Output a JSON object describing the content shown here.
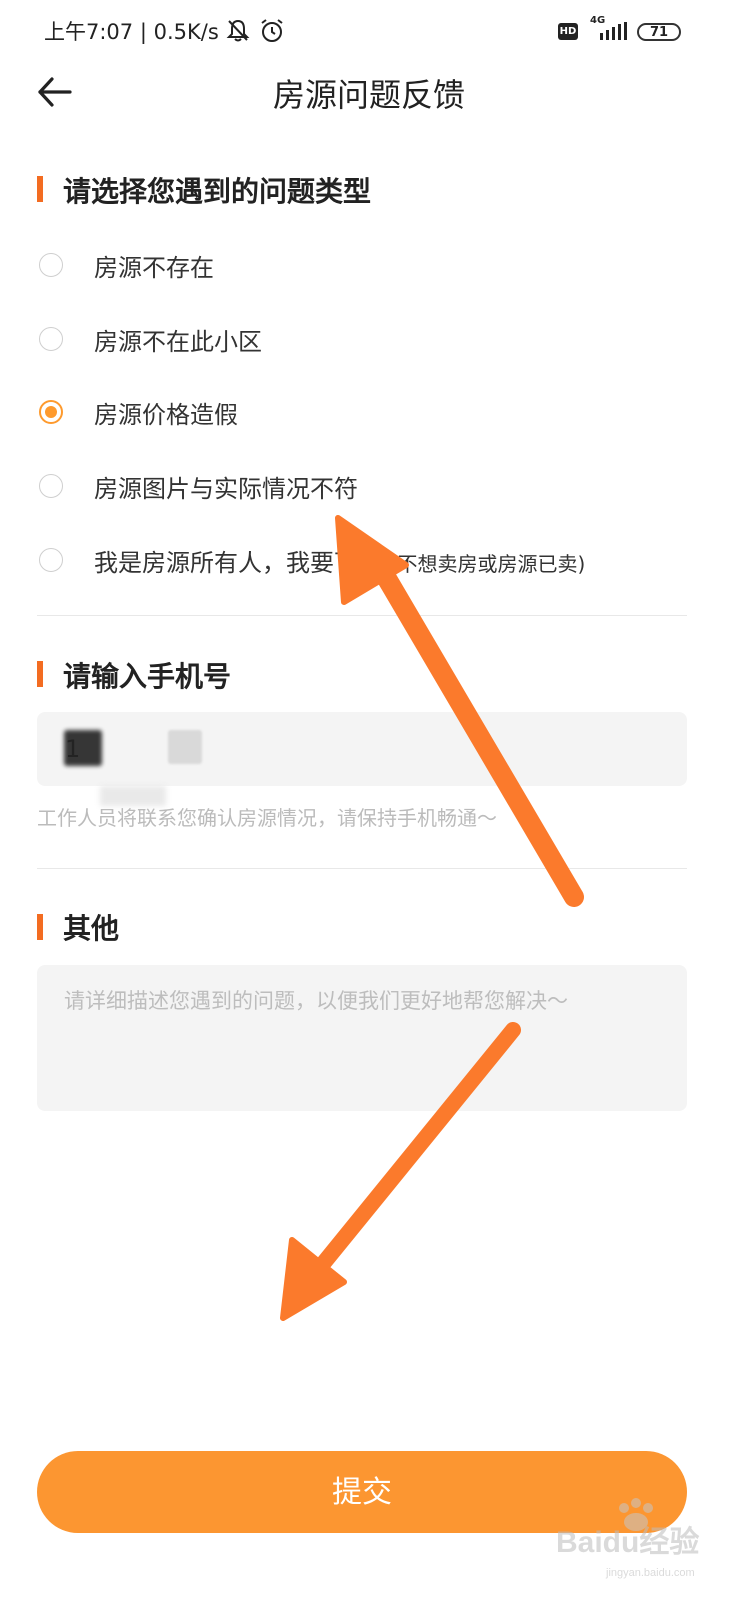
{
  "status_bar": {
    "time_speed": "上午7:07 | 0.5K/s",
    "hd": "HD",
    "network": "4G",
    "battery": "71"
  },
  "header": {
    "title": "房源问题反馈"
  },
  "problem_section": {
    "title": "请选择您遇到的问题类型",
    "options": [
      {
        "label": "房源不存在",
        "note": "",
        "checked": false
      },
      {
        "label": "房源不在此小区",
        "note": "",
        "checked": false
      },
      {
        "label": "房源价格造假",
        "note": "",
        "checked": true
      },
      {
        "label": "房源图片与实际情况不符",
        "note": "",
        "checked": false
      },
      {
        "label": "我是房源所有人，我要下架",
        "note": "(不想卖房或房源已卖)",
        "checked": false
      }
    ]
  },
  "phone_section": {
    "title": "请输入手机号",
    "value": "1",
    "hint": "工作人员将联系您确认房源情况，请保持手机畅通～"
  },
  "other_section": {
    "title": "其他",
    "placeholder": "请详细描述您遇到的问题，以便我们更好地帮您解决～"
  },
  "submit": {
    "label": "提交"
  },
  "watermark": {
    "text": "Baidu经验",
    "url": "jingyan.baidu.com"
  },
  "colors": {
    "accent": "#f36c21",
    "radio_checked": "#fe9a2d",
    "submit": "#fc9631",
    "annotation_arrow": "#fb7a2c"
  }
}
